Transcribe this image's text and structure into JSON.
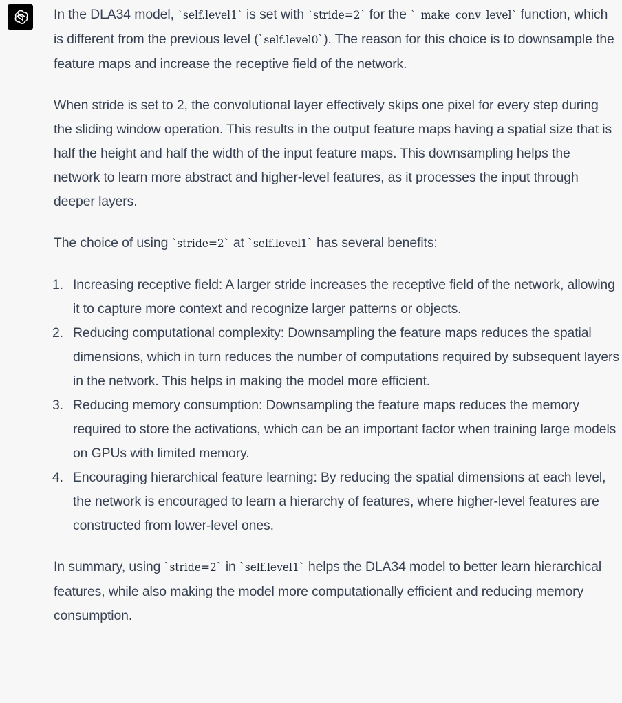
{
  "avatar": {
    "icon": "openai-logo-icon",
    "background": "#000000"
  },
  "p1": {
    "t1": "In the DLA34 model, ",
    "c1": "`self.level1`",
    "t2": " is set with ",
    "c2": "`stride=2`",
    "t3": " for the ",
    "c3": "`_make_conv_level`",
    "t4": " function, which is different from the previous level (",
    "c4": "`self.level0`",
    "t5": "). The reason for this choice is to downsample the feature maps and increase the receptive field of the network."
  },
  "p2": {
    "text": "When stride is set to 2, the convolutional layer effectively skips one pixel for every step during the sliding window operation. This results in the output feature maps having a spatial size that is half the height and half the width of the input feature maps. This downsampling helps the network to learn more abstract and higher-level features, as it processes the input through deeper layers."
  },
  "p3": {
    "t1": "The choice of using ",
    "c1": "`stride=2`",
    "t2": " at ",
    "c2": "`self.level1`",
    "t3": " has several benefits:"
  },
  "benefits": [
    {
      "num": "1.",
      "text": "Increasing receptive field: A larger stride increases the receptive field of the network, allowing it to capture more context and recognize larger patterns or objects."
    },
    {
      "num": "2.",
      "text": "Reducing computational complexity: Downsampling the feature maps reduces the spatial dimensions, which in turn reduces the number of computations required by subsequent layers in the network. This helps in making the model more efficient."
    },
    {
      "num": "3.",
      "text": "Reducing memory consumption: Downsampling the feature maps reduces the memory required to store the activations, which can be an important factor when training large models on GPUs with limited memory."
    },
    {
      "num": "4.",
      "text": "Encouraging hierarchical feature learning: By reducing the spatial dimensions at each level, the network is encouraged to learn a hierarchy of features, where higher-level features are constructed from lower-level ones."
    }
  ],
  "p4": {
    "t1": "In summary, using ",
    "c1": "`stride=2`",
    "t2": " in ",
    "c2": "`self.level1`",
    "t3": " helps the DLA34 model to better learn hierarchical features, while also making the model more computationally efficient and reducing memory consumption."
  }
}
